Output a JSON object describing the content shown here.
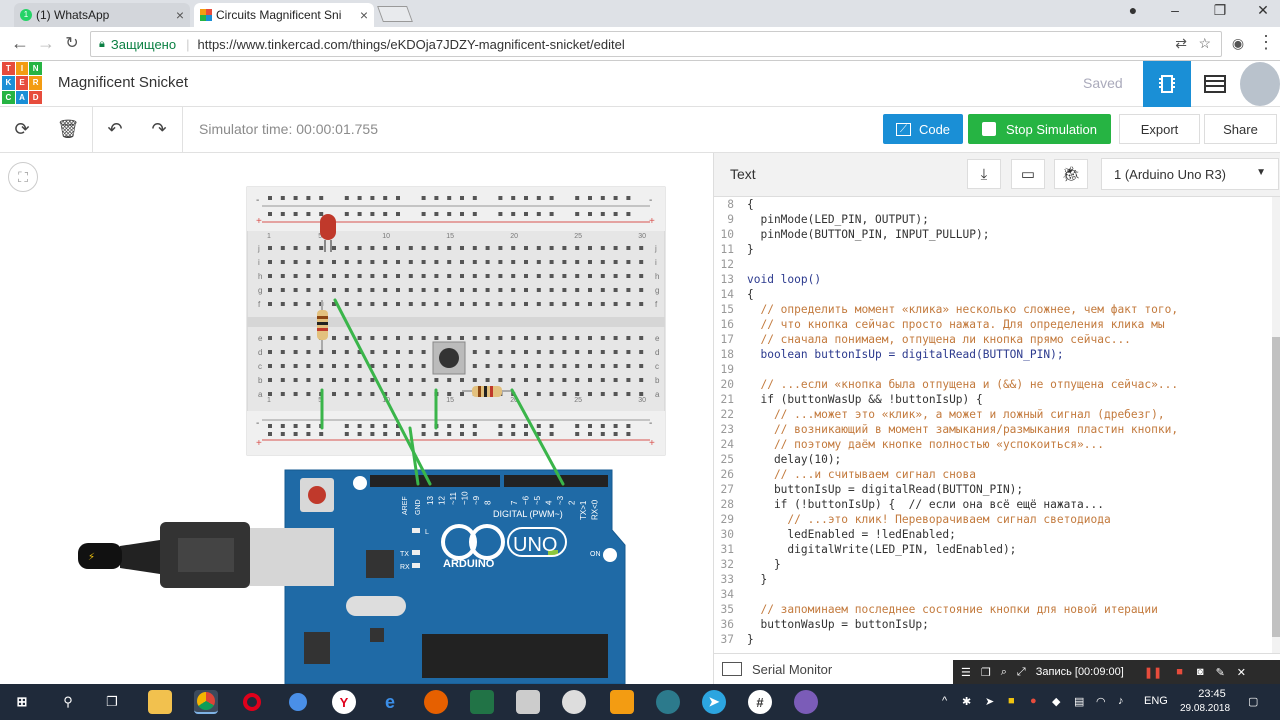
{
  "browser": {
    "tabs": [
      {
        "title": "(1) WhatsApp",
        "badge": "1"
      },
      {
        "title": "Circuits Magnificent Snicket"
      }
    ],
    "secure_label": "Защищено",
    "url": "https://www.tinkercad.com/things/eKDOja7JDZY-magnificent-snicket/editel"
  },
  "app": {
    "logo_letters": [
      "T",
      "I",
      "N",
      "K",
      "E",
      "R",
      "C",
      "A",
      "D"
    ],
    "project_title": "Magnificent Snicket",
    "saved_label": "Saved"
  },
  "toolbar": {
    "sim_time": "Simulator time: 00:00:01.755",
    "code_label": "Code",
    "stop_label": "Stop Simulation",
    "export_label": "Export",
    "share_label": "Share"
  },
  "code_panel": {
    "mode_label": "Text",
    "device": "1 (Arduino Uno R3)",
    "serial_monitor": "Serial Monitor",
    "lines": [
      {
        "n": "8",
        "t": "{"
      },
      {
        "n": "9",
        "t": "  pinMode(LED_PIN, OUTPUT);"
      },
      {
        "n": "10",
        "t": "  pinMode(BUTTON_PIN, INPUT_PULLUP);"
      },
      {
        "n": "11",
        "t": "}"
      },
      {
        "n": "12",
        "t": ""
      },
      {
        "n": "13",
        "t": "void loop()"
      },
      {
        "n": "14",
        "t": "{"
      },
      {
        "n": "15",
        "t": "  // определить момент «клика» несколько сложнее, чем факт того,"
      },
      {
        "n": "16",
        "t": "  // что кнопка сейчас просто нажата. Для определения клика мы"
      },
      {
        "n": "17",
        "t": "  // сначала понимаем, отпущена ли кнопка прямо сейчас..."
      },
      {
        "n": "18",
        "t": "  boolean buttonIsUp = digitalRead(BUTTON_PIN);"
      },
      {
        "n": "19",
        "t": ""
      },
      {
        "n": "20",
        "t": "  // ...если «кнопка была отпущена и (&&) не отпущена сейчас»..."
      },
      {
        "n": "21",
        "t": "  if (buttonWasUp && !buttonIsUp) {"
      },
      {
        "n": "22",
        "t": "    // ...может это «клик», а может и ложный сигнал (дребезг),"
      },
      {
        "n": "23",
        "t": "    // возникающий в момент замыкания/размыкания пластин кнопки,"
      },
      {
        "n": "24",
        "t": "    // поэтому даём кнопке полностью «успокоиться»..."
      },
      {
        "n": "25",
        "t": "    delay(10);"
      },
      {
        "n": "26",
        "t": "    // ...и считываем сигнал снова"
      },
      {
        "n": "27",
        "t": "    buttonIsUp = digitalRead(BUTTON_PIN);"
      },
      {
        "n": "28",
        "t": "    if (!buttonIsUp) {  // если она всё ещё нажата..."
      },
      {
        "n": "29",
        "t": "      // ...это клик! Переворачиваем сигнал светодиода"
      },
      {
        "n": "30",
        "t": "      ledEnabled = !ledEnabled;"
      },
      {
        "n": "31",
        "t": "      digitalWrite(LED_PIN, ledEnabled);"
      },
      {
        "n": "32",
        "t": "    }"
      },
      {
        "n": "33",
        "t": "  }"
      },
      {
        "n": "34",
        "t": ""
      },
      {
        "n": "35",
        "t": "  // запоминаем последнее состояние кнопки для новой итерации"
      },
      {
        "n": "36",
        "t": "  buttonWasUp = buttonIsUp;"
      },
      {
        "n": "37",
        "t": "}"
      }
    ]
  },
  "board": {
    "col_numbers": [
      "1",
      "5",
      "10",
      "15",
      "20",
      "25",
      "30"
    ],
    "row_letters_top": [
      "j",
      "i",
      "h",
      "g",
      "f"
    ],
    "row_letters_bottom": [
      "e",
      "d",
      "c",
      "b",
      "a"
    ],
    "aref": "AREF",
    "gnd": "GND",
    "pins": [
      "13",
      "12",
      "~11",
      "~10",
      "~9",
      "8",
      "7",
      "~6",
      "~5",
      "4",
      "~3",
      "2",
      "TX>1",
      "RX<0"
    ],
    "digital_label": "DIGITAL (PWM~)",
    "uno": "UNO",
    "arduino": "ARDUINO",
    "on": "ON",
    "led_labels": [
      "L",
      "TX",
      "RX"
    ]
  },
  "recorder": {
    "label": "Запись [00:09:00]"
  },
  "taskbar": {
    "lang": "ENG",
    "time": "23:45",
    "date": "29.08.2018"
  },
  "colors": {
    "accent": "#1a8fd6",
    "stop": "#26b443",
    "arduino": "#1f6aa6",
    "wire": "#3ab54a",
    "comment": "#c37a3d"
  }
}
